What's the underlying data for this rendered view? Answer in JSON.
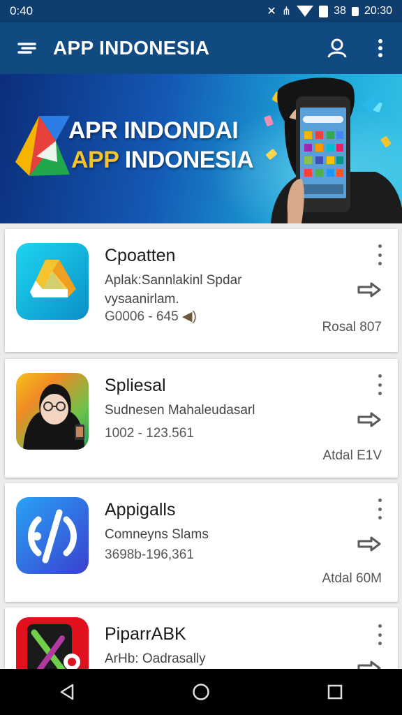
{
  "status_bar": {
    "time_left": "0:40",
    "battery_text": "38",
    "time_right": "20:30"
  },
  "app_bar": {
    "title": "APP INDONESIA",
    "icons": [
      "menu-icon",
      "account-icon",
      "more-vert-icon"
    ]
  },
  "banner": {
    "line1": "APR INDONDAI",
    "line2_a": "APP",
    "line2_b": "INDONESIA"
  },
  "apps": [
    {
      "title": "Cpoatten",
      "desc1": "Aplak:Sannlakinl Spdar",
      "desc2": "vysaanirlam.",
      "stat": "G0006 - 645",
      "meta": "Rosal 807",
      "icon": "drive-triangle-icon",
      "colors": [
        "#1ec8e8",
        "#0a93c9"
      ]
    },
    {
      "title": "Spliesal",
      "desc1": "Sudnesen Mahaleudasarl",
      "stat": "1002 - 123.561",
      "meta": "Atdal E1V",
      "icon": "hijab-avatar-icon"
    },
    {
      "title": "Appigalls",
      "desc1": "Comneyns Slams",
      "stat": "3698b-196,361",
      "meta": "Atdal 60M",
      "icon": "slash-circle-icon",
      "colors": [
        "#2a8df0",
        "#3b3fcf"
      ]
    },
    {
      "title": "PiparrABK",
      "desc1": "ArHb: Oadrasally",
      "icon": "red-tools-icon"
    }
  ]
}
